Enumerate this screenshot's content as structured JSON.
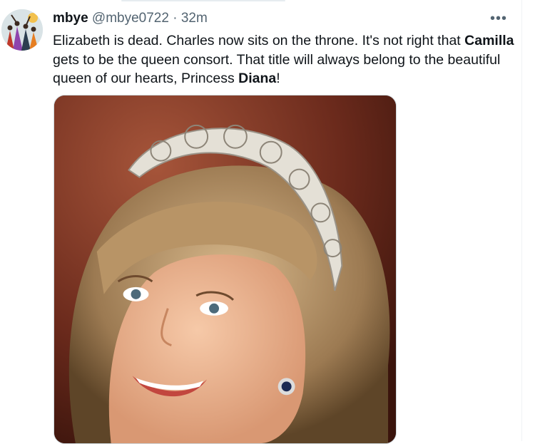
{
  "tweet": {
    "author_name": "mbye",
    "author_handle": "@mbye0722",
    "separator": "·",
    "time": "32m",
    "more_icon": "more-horizontal-icon",
    "text_segments": [
      {
        "text": "Elizabeth is dead. Charles now sits on the throne. It's not right that ",
        "bold": false
      },
      {
        "text": "Camilla",
        "bold": true
      },
      {
        "text": " gets to be the queen consort. That title will always belong to the beautiful queen of our hearts, Princess ",
        "bold": false
      },
      {
        "text": "Diana",
        "bold": true
      },
      {
        "text": "!",
        "bold": false
      }
    ]
  },
  "colors": {
    "text": "#0f1419",
    "secondary": "#536471",
    "border": "#cfd9de"
  }
}
